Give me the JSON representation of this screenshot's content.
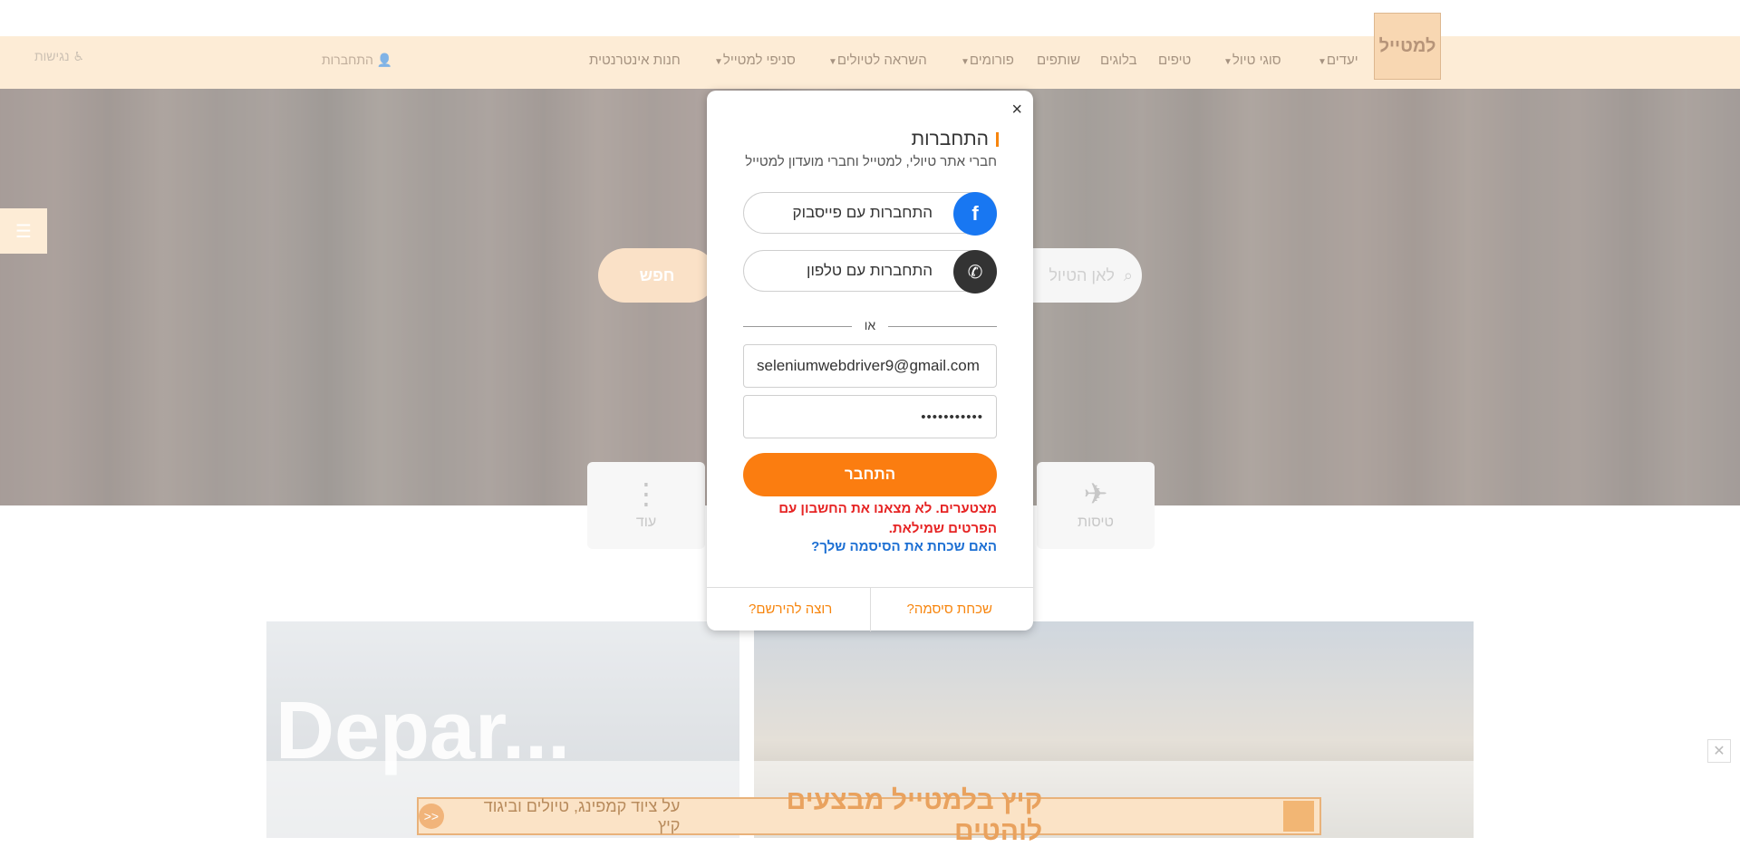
{
  "header": {
    "logo_text": "למטייל",
    "nav": [
      {
        "label": "יעדים",
        "dropdown": true
      },
      {
        "label": "סוגי טיול",
        "dropdown": true
      },
      {
        "label": "טיפים",
        "dropdown": false
      },
      {
        "label": "בלוגים",
        "dropdown": false
      },
      {
        "label": "שותפים",
        "dropdown": false
      },
      {
        "label": "פורומים",
        "dropdown": true
      },
      {
        "label": "השראה לטיולים",
        "dropdown": true
      },
      {
        "label": "סניפי למטייל",
        "dropdown": true
      },
      {
        "label": "חנות אינטרנטית",
        "dropdown": false
      }
    ],
    "login": "התחברות",
    "accessibility": "נגישות"
  },
  "hero": {
    "search_placeholder": "לאן הטיול",
    "search_button": "חפש"
  },
  "categories": [
    {
      "label": "טיסות",
      "icon": "airplane-icon"
    },
    {
      "label": "עוד",
      "icon": "more-vertical-icon"
    }
  ],
  "cards": {
    "left_image_text": "Depar..."
  },
  "banner": {
    "title": "קיץ בלמטייל מבצעים לוהטים",
    "subtitle": "על ציוד קמפינג, טיולים וביגוד קיץ",
    "arrow": "<<"
  },
  "modal": {
    "close": "×",
    "title": "התחברות",
    "subtitle": "חברי אתר טיולי, למטייל וחברי מועדון למטייל",
    "facebook_label": "התחברות עם פייסבוק",
    "phone_label": "התחברות עם טלפון",
    "or": "או",
    "email_value": "seleniumwebdriver9@gmail.com",
    "password_value": "•••••••••••",
    "submit": "התחבר",
    "error": "מצטערים. לא מצאנו את החשבון עם הפרטים שמילאת.",
    "forgot_link": "האם שכחת את הסיסמה שלך?",
    "footer_forgot": "שכחת סיסמה?",
    "footer_register": "רוצה להירשם?"
  },
  "colors": {
    "accent": "#fb7d10",
    "facebook": "#1877f2",
    "phone": "#333333",
    "error": "#e62424",
    "link": "#1c6fd3"
  }
}
